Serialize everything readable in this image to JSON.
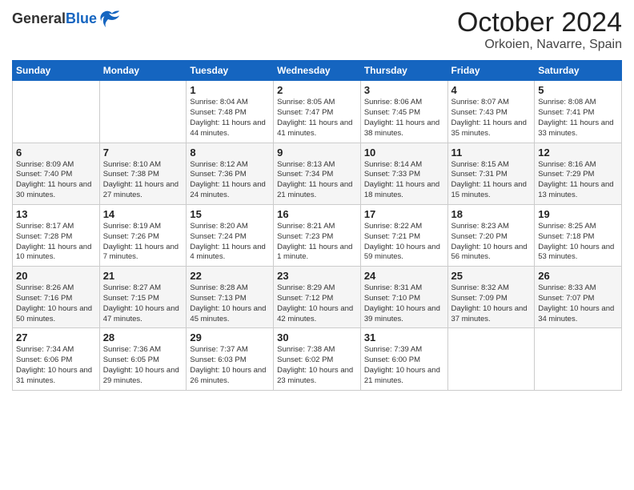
{
  "header": {
    "logo_line1": "General",
    "logo_line2": "Blue",
    "title": "October 2024",
    "subtitle": "Orkoien, Navarre, Spain"
  },
  "days_of_week": [
    "Sunday",
    "Monday",
    "Tuesday",
    "Wednesday",
    "Thursday",
    "Friday",
    "Saturday"
  ],
  "weeks": [
    [
      {
        "day": "",
        "info": ""
      },
      {
        "day": "",
        "info": ""
      },
      {
        "day": "1",
        "info": "Sunrise: 8:04 AM\nSunset: 7:48 PM\nDaylight: 11 hours\nand 44 minutes."
      },
      {
        "day": "2",
        "info": "Sunrise: 8:05 AM\nSunset: 7:47 PM\nDaylight: 11 hours\nand 41 minutes."
      },
      {
        "day": "3",
        "info": "Sunrise: 8:06 AM\nSunset: 7:45 PM\nDaylight: 11 hours\nand 38 minutes."
      },
      {
        "day": "4",
        "info": "Sunrise: 8:07 AM\nSunset: 7:43 PM\nDaylight: 11 hours\nand 35 minutes."
      },
      {
        "day": "5",
        "info": "Sunrise: 8:08 AM\nSunset: 7:41 PM\nDaylight: 11 hours\nand 33 minutes."
      }
    ],
    [
      {
        "day": "6",
        "info": "Sunrise: 8:09 AM\nSunset: 7:40 PM\nDaylight: 11 hours\nand 30 minutes."
      },
      {
        "day": "7",
        "info": "Sunrise: 8:10 AM\nSunset: 7:38 PM\nDaylight: 11 hours\nand 27 minutes."
      },
      {
        "day": "8",
        "info": "Sunrise: 8:12 AM\nSunset: 7:36 PM\nDaylight: 11 hours\nand 24 minutes."
      },
      {
        "day": "9",
        "info": "Sunrise: 8:13 AM\nSunset: 7:34 PM\nDaylight: 11 hours\nand 21 minutes."
      },
      {
        "day": "10",
        "info": "Sunrise: 8:14 AM\nSunset: 7:33 PM\nDaylight: 11 hours\nand 18 minutes."
      },
      {
        "day": "11",
        "info": "Sunrise: 8:15 AM\nSunset: 7:31 PM\nDaylight: 11 hours\nand 15 minutes."
      },
      {
        "day": "12",
        "info": "Sunrise: 8:16 AM\nSunset: 7:29 PM\nDaylight: 11 hours\nand 13 minutes."
      }
    ],
    [
      {
        "day": "13",
        "info": "Sunrise: 8:17 AM\nSunset: 7:28 PM\nDaylight: 11 hours\nand 10 minutes."
      },
      {
        "day": "14",
        "info": "Sunrise: 8:19 AM\nSunset: 7:26 PM\nDaylight: 11 hours\nand 7 minutes."
      },
      {
        "day": "15",
        "info": "Sunrise: 8:20 AM\nSunset: 7:24 PM\nDaylight: 11 hours\nand 4 minutes."
      },
      {
        "day": "16",
        "info": "Sunrise: 8:21 AM\nSunset: 7:23 PM\nDaylight: 11 hours\nand 1 minute."
      },
      {
        "day": "17",
        "info": "Sunrise: 8:22 AM\nSunset: 7:21 PM\nDaylight: 10 hours\nand 59 minutes."
      },
      {
        "day": "18",
        "info": "Sunrise: 8:23 AM\nSunset: 7:20 PM\nDaylight: 10 hours\nand 56 minutes."
      },
      {
        "day": "19",
        "info": "Sunrise: 8:25 AM\nSunset: 7:18 PM\nDaylight: 10 hours\nand 53 minutes."
      }
    ],
    [
      {
        "day": "20",
        "info": "Sunrise: 8:26 AM\nSunset: 7:16 PM\nDaylight: 10 hours\nand 50 minutes."
      },
      {
        "day": "21",
        "info": "Sunrise: 8:27 AM\nSunset: 7:15 PM\nDaylight: 10 hours\nand 47 minutes."
      },
      {
        "day": "22",
        "info": "Sunrise: 8:28 AM\nSunset: 7:13 PM\nDaylight: 10 hours\nand 45 minutes."
      },
      {
        "day": "23",
        "info": "Sunrise: 8:29 AM\nSunset: 7:12 PM\nDaylight: 10 hours\nand 42 minutes."
      },
      {
        "day": "24",
        "info": "Sunrise: 8:31 AM\nSunset: 7:10 PM\nDaylight: 10 hours\nand 39 minutes."
      },
      {
        "day": "25",
        "info": "Sunrise: 8:32 AM\nSunset: 7:09 PM\nDaylight: 10 hours\nand 37 minutes."
      },
      {
        "day": "26",
        "info": "Sunrise: 8:33 AM\nSunset: 7:07 PM\nDaylight: 10 hours\nand 34 minutes."
      }
    ],
    [
      {
        "day": "27",
        "info": "Sunrise: 7:34 AM\nSunset: 6:06 PM\nDaylight: 10 hours\nand 31 minutes."
      },
      {
        "day": "28",
        "info": "Sunrise: 7:36 AM\nSunset: 6:05 PM\nDaylight: 10 hours\nand 29 minutes."
      },
      {
        "day": "29",
        "info": "Sunrise: 7:37 AM\nSunset: 6:03 PM\nDaylight: 10 hours\nand 26 minutes."
      },
      {
        "day": "30",
        "info": "Sunrise: 7:38 AM\nSunset: 6:02 PM\nDaylight: 10 hours\nand 23 minutes."
      },
      {
        "day": "31",
        "info": "Sunrise: 7:39 AM\nSunset: 6:00 PM\nDaylight: 10 hours\nand 21 minutes."
      },
      {
        "day": "",
        "info": ""
      },
      {
        "day": "",
        "info": ""
      }
    ]
  ]
}
